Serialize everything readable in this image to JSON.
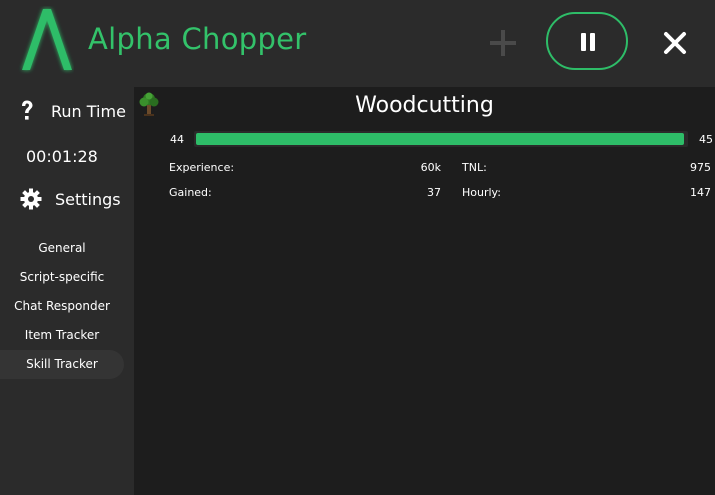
{
  "app": {
    "title": "Alpha Chopper",
    "accent_color": "#2ebd68"
  },
  "header": {
    "plus_icon": "plus-icon",
    "pause_icon": "pause-icon",
    "close_icon": "close-icon"
  },
  "sidebar": {
    "runtime_label": "Run Time",
    "runtime_value": "00:01:28",
    "settings_label": "Settings",
    "items": [
      {
        "label": "General",
        "active": false
      },
      {
        "label": "Script-specific",
        "active": false
      },
      {
        "label": "Chat Responder",
        "active": false
      },
      {
        "label": "Item Tracker",
        "active": false
      },
      {
        "label": "Skill Tracker",
        "active": true
      }
    ]
  },
  "skill": {
    "name": "Woodcutting",
    "icon": "tree-icon",
    "current_level": "44",
    "next_level": "45",
    "progress_fraction": 0.995,
    "stats": {
      "experience_label": "Experience:",
      "experience_value": "60k",
      "tnl_label": "TNL:",
      "tnl_value": "975",
      "gained_label": "Gained:",
      "gained_value": "37",
      "hourly_label": "Hourly:",
      "hourly_value": "147"
    }
  }
}
